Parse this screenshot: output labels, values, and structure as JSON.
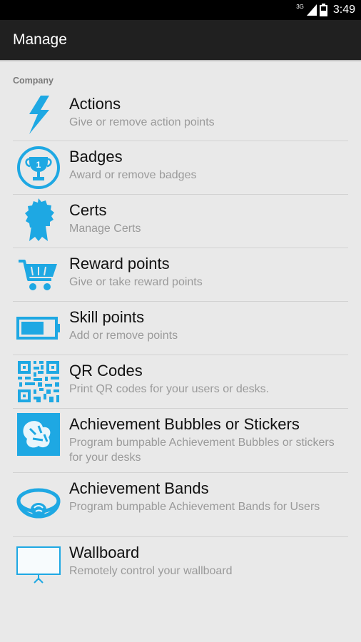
{
  "status_bar": {
    "network": "3G",
    "time": "3:49"
  },
  "action_bar": {
    "title": "Manage"
  },
  "section": {
    "header": "Company"
  },
  "items": [
    {
      "title": "Actions",
      "subtitle": "Give or remove action points",
      "icon": "lightning-icon"
    },
    {
      "title": "Badges",
      "subtitle": "Award or remove badges",
      "icon": "trophy-badge-icon",
      "icon_text": "1"
    },
    {
      "title": "Certs",
      "subtitle": "Manage Certs",
      "icon": "rosette-icon"
    },
    {
      "title": "Reward points",
      "subtitle": "Give or take reward points",
      "icon": "cart-icon"
    },
    {
      "title": "Skill points",
      "subtitle": "Add or remove points",
      "icon": "battery-icon"
    },
    {
      "title": "QR Codes",
      "subtitle": "Print QR codes for your users or desks.",
      "icon": "qr-code-icon"
    },
    {
      "title": "Achievement Bubbles or Stickers",
      "subtitle": "Program bumpable Achievement Bubbles or stickers for your desks",
      "icon": "sticker-icon"
    },
    {
      "title": "Achievement Bands",
      "subtitle": "Program bumpable Achievement Bands for Users",
      "icon": "wristband-icon"
    },
    {
      "title": "Wallboard",
      "subtitle": "Remotely control your wallboard",
      "icon": "wallboard-icon"
    }
  ],
  "colors": {
    "accent": "#1ea8e3",
    "background": "#e9e9e9",
    "action_bar": "#202020"
  }
}
